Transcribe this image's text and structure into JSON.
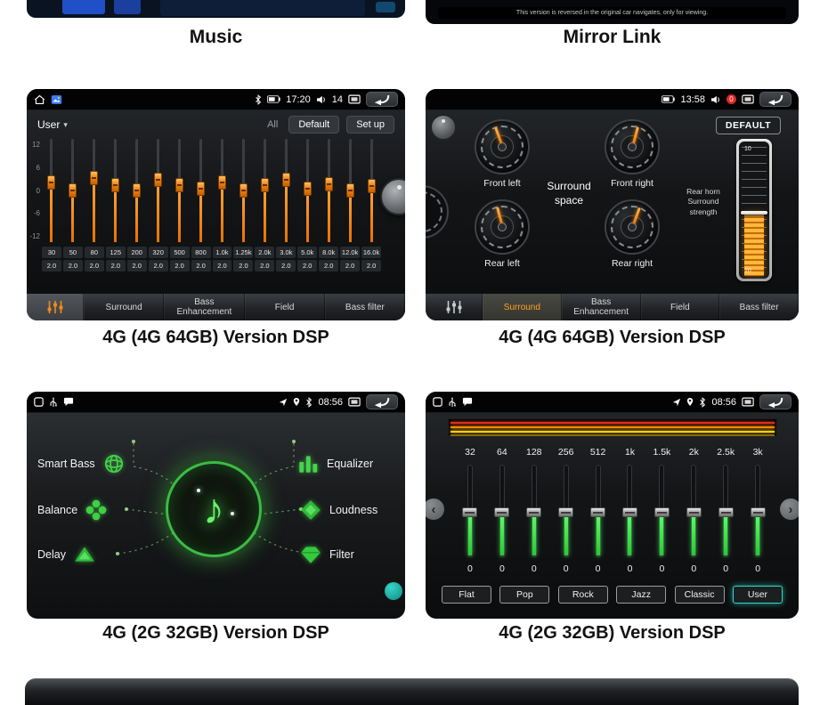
{
  "icons": {
    "music_note": "♪",
    "chevron_left": "‹",
    "chevron_right": "›",
    "dropdown_caret": "▾"
  },
  "colors": {
    "accent_orange": "#f28a18",
    "accent_green": "#46d24c",
    "accent_teal": "#18b2a8"
  },
  "captions": {
    "music": "Music",
    "mirror_link": "Mirror Link",
    "mid_left": "4G (4G 64GB) Version DSP",
    "mid_right": "4G (4G 64GB) Version DSP",
    "bottom_left": "4G (2G 32GB) Version DSP",
    "bottom_right": "4G (2G 32GB) Version DSP"
  },
  "mirror_screen": {
    "note": "This version is reversed in the original car navigates, only for viewing."
  },
  "eq_panel": {
    "status": {
      "time": "17:20",
      "volume": "14"
    },
    "toolbar": {
      "user": "User",
      "all": "All",
      "default": "Default",
      "setup": "Set up"
    },
    "axis": [
      "12",
      "6",
      "0",
      "-6",
      "-12"
    ],
    "bands": [
      {
        "freq": "30",
        "q": "2.0",
        "level": 58
      },
      {
        "freq": "50",
        "q": "2.0",
        "level": 50
      },
      {
        "freq": "80",
        "q": "2.0",
        "level": 62
      },
      {
        "freq": "125",
        "q": "2.0",
        "level": 55
      },
      {
        "freq": "200",
        "q": "2.0",
        "level": 50
      },
      {
        "freq": "320",
        "q": "2.0",
        "level": 60
      },
      {
        "freq": "500",
        "q": "2.0",
        "level": 55
      },
      {
        "freq": "800",
        "q": "2.0",
        "level": 52
      },
      {
        "freq": "1.0k",
        "q": "2.0",
        "level": 58
      },
      {
        "freq": "1.25k",
        "q": "2.0",
        "level": 50
      },
      {
        "freq": "2.0k",
        "q": "2.0",
        "level": 55
      },
      {
        "freq": "3.0k",
        "q": "2.0",
        "level": 60
      },
      {
        "freq": "5.0k",
        "q": "2.0",
        "level": 52
      },
      {
        "freq": "8.0k",
        "q": "2.0",
        "level": 56
      },
      {
        "freq": "12.0k",
        "q": "2.0",
        "level": 50
      },
      {
        "freq": "16.0k",
        "q": "2.0",
        "level": 54
      }
    ],
    "tabs": [
      "Surround",
      "Bass Enhancement",
      "Field",
      "Bass filter"
    ]
  },
  "surround_panel": {
    "status": {
      "time": "13:58",
      "volume": "0"
    },
    "default_button": "DEFAULT",
    "space_label": "Surround space",
    "gauges": [
      {
        "label": "Front left",
        "angle": -20
      },
      {
        "label": "Front right",
        "angle": 15
      },
      {
        "label": "Rear left",
        "angle": -15
      },
      {
        "label": "Rear right",
        "angle": 20
      }
    ],
    "strength": {
      "line1": "Rear horn",
      "line2": "Surround strength",
      "scale_top": "10",
      "scale_bottom": "10",
      "level": 46
    },
    "tabs": [
      "Surround",
      "Bass Enhancement",
      "Field",
      "Bass filter"
    ]
  },
  "dsp_panel": {
    "status": {
      "time": "08:56"
    },
    "items_left": [
      {
        "label": "Smart Bass"
      },
      {
        "label": "Balance"
      },
      {
        "label": "Delay"
      }
    ],
    "items_right": [
      {
        "label": "Equalizer"
      },
      {
        "label": "Loudness"
      },
      {
        "label": "Filter"
      }
    ]
  },
  "green_eq_panel": {
    "status": {
      "time": "08:56"
    },
    "bands": [
      {
        "freq": "32",
        "value": "0"
      },
      {
        "freq": "64",
        "value": "0"
      },
      {
        "freq": "128",
        "value": "0"
      },
      {
        "freq": "256",
        "value": "0"
      },
      {
        "freq": "512",
        "value": "0"
      },
      {
        "freq": "1k",
        "value": "0"
      },
      {
        "freq": "1.5k",
        "value": "0"
      },
      {
        "freq": "2k",
        "value": "0"
      },
      {
        "freq": "2.5k",
        "value": "0"
      },
      {
        "freq": "3k",
        "value": "0"
      }
    ],
    "presets": [
      "Flat",
      "Pop",
      "Rock",
      "Jazz",
      "Classic",
      "User"
    ]
  }
}
